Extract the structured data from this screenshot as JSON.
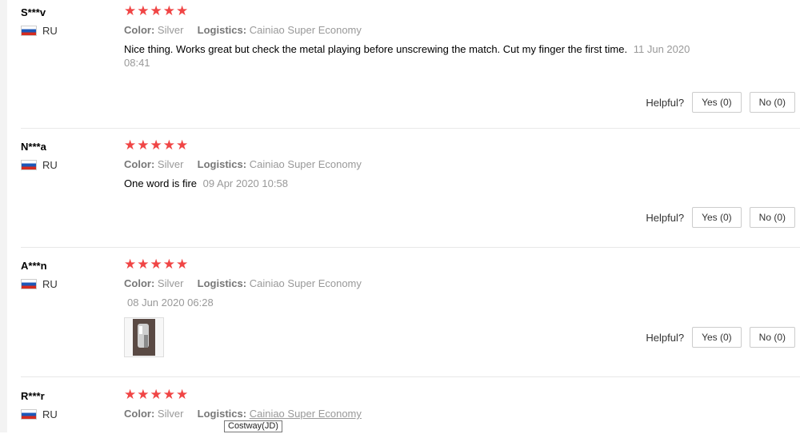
{
  "labels": {
    "color": "Color:",
    "logistics": "Logistics:",
    "helpful": "Helpful?",
    "yes": "Yes (0)",
    "no": "No (0)"
  },
  "reviews": [
    {
      "user": "S***v",
      "country": "RU",
      "rating": "★★★★★",
      "color": "Silver",
      "logistics": "Cainiao Super Economy",
      "text": "Nice thing. Works great but check the metal playing before unscrewing the match. Cut my finger the first time.",
      "date": "11 Jun 2020 08:41"
    },
    {
      "user": "N***a",
      "country": "RU",
      "rating": "★★★★★",
      "color": "Silver",
      "logistics": "Cainiao Super Economy",
      "text": "One word is fire",
      "date": "09 Apr 2020 10:58"
    },
    {
      "user": "A***n",
      "country": "RU",
      "rating": "★★★★★",
      "color": "Silver",
      "logistics": "Cainiao Super Economy",
      "text": "",
      "date": "08 Jun 2020 06:28"
    },
    {
      "user": "R***r",
      "country": "RU",
      "rating": "★★★★★",
      "color": "Silver",
      "logistics": "Cainiao Super Economy"
    }
  ],
  "tooltip": "Costway(JD)"
}
